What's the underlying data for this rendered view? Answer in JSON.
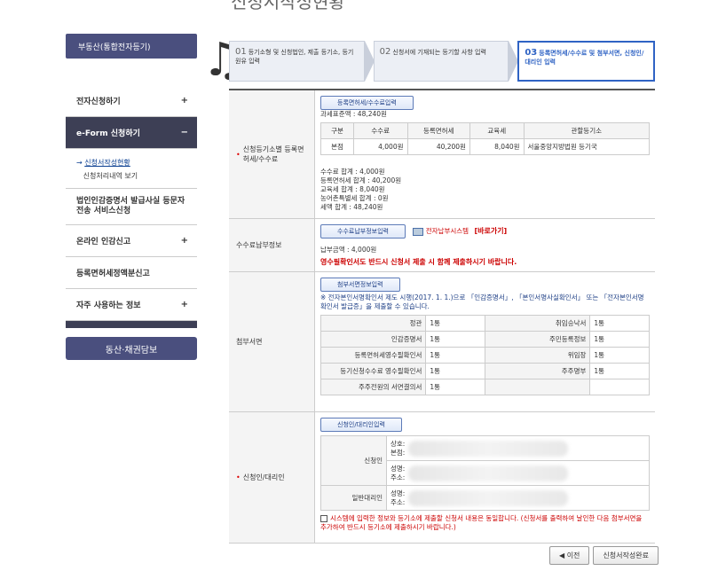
{
  "top": {
    "title": "신청서작성현황"
  },
  "sidebar": {
    "head": "부동산(통합전자등기)",
    "items": [
      {
        "label": "전자신청하기",
        "icon": "+"
      },
      {
        "label": "e-Form 신청하기",
        "icon": "−"
      },
      {
        "label": "법인인감증명서 발급사실 등문자전송 서비스신청"
      },
      {
        "label": "온라인 인감신고",
        "icon": "+"
      },
      {
        "label": "등록면허세정액분신고"
      },
      {
        "label": "자주 사용하는 정보",
        "icon": "+"
      }
    ],
    "submenu": {
      "current": "신청서작성현황",
      "other": "신청처리내역 보기"
    },
    "bottom_button": "동산·채권담보"
  },
  "steps": [
    {
      "num": "01",
      "label": "등기소형 및 신청법인, 제출 등기소, 등기원유 입력"
    },
    {
      "num": "02",
      "label": "신청서에 기재되는 등기할 사항 입력"
    },
    {
      "num": "03",
      "label": "등록면허세/수수료 및 첨부서면, 신청인/대리인 입력"
    }
  ],
  "form": {
    "fee_section": {
      "label": "신청등기소별 등록면허세/수수료",
      "button": "등록면허세/수수료입력",
      "tax_base": "과세표준액 : 48,240원",
      "headers": [
        "구분",
        "수수료",
        "등록면허세",
        "교육세",
        "관할등기소"
      ],
      "row": [
        "본점",
        "4,000원",
        "40,200원",
        "8,040원",
        "서울중앙지방법원 등기국"
      ],
      "summary": [
        "수수료 합계 : 4,000원",
        "등록면허세 합계 : 40,200원",
        "교육세 합계 : 8,040원",
        "농어촌특별세 합계 : 0원",
        "세액 합계 : 48,240원"
      ]
    },
    "payment_section": {
      "label": "수수료납부정보",
      "button": "수수료납부정보입력",
      "link_text": "전자납부시스템",
      "link_action": "[바로가기]",
      "amount": "납부금액 : 4,000원",
      "warning": "영수필확인서도 반드시 신청서 제출 시 함께 제출하시기 바랍니다."
    },
    "attach_section": {
      "label": "첨부서면",
      "button": "첨부서면정보입력",
      "notice": "※ 전자본인서명확인서 제도 시행(2017. 1. 1.)으로 「인감증명서」, 「본인서명사실확인서」 또는 「전자본인서명확인서 발급증」을 제출할 수 있습니다.",
      "rows": [
        [
          "정관",
          "1통",
          "취임승낙서",
          "1통"
        ],
        [
          "인감증명서",
          "1통",
          "주민등록정보",
          "1통"
        ],
        [
          "등록면허세영수필확인서",
          "1통",
          "위임장",
          "1통"
        ],
        [
          "등기신청수수료 영수필확인서",
          "1통",
          "주주명부",
          "1통"
        ],
        [
          "주주전원의 서면결의서",
          "1통",
          "",
          ""
        ]
      ]
    },
    "applicant_section": {
      "label": "신청인/대리인",
      "button": "신청인/대리인입력",
      "applicant_label": "신청인",
      "applicant_fields": [
        "상호:",
        "본점:"
      ],
      "rep_fields": [
        "성명:",
        "주소:"
      ],
      "agent_label": "일반대리인",
      "agent_fields": [
        "성명:",
        "주소:"
      ],
      "agree_text": "시스템에 입력한 정보와 등기소에 제출할 신청서 내용은 동일합니다. (신청서를 출력하여 날인한 다음 첨부서면을 추가하여 반드시 등기소에 제출하시기 바랍니다.)"
    }
  },
  "buttons": {
    "prev": "◀ 이전",
    "complete": "신청서작성완료"
  }
}
